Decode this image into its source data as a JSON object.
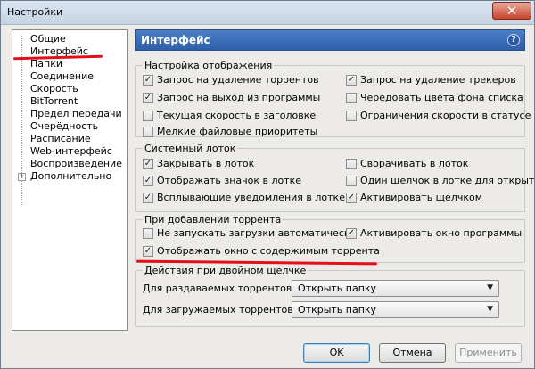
{
  "window": {
    "title": "Настройки",
    "close": "✕"
  },
  "sidebar": {
    "items": [
      {
        "label": "Общие"
      },
      {
        "label": "Интерфейс"
      },
      {
        "label": "Папки"
      },
      {
        "label": "Соединение"
      },
      {
        "label": "Скорость"
      },
      {
        "label": "BitTorrent"
      },
      {
        "label": "Предел передачи"
      },
      {
        "label": "Очерёдность"
      },
      {
        "label": "Расписание"
      },
      {
        "label": "Web-интерфейс"
      },
      {
        "label": "Воспроизведение"
      },
      {
        "label": "Дополнительно"
      }
    ],
    "expander": "+"
  },
  "header": {
    "title": "Интерфейс",
    "help": "?"
  },
  "display_group": {
    "title": "Настройка отображения",
    "options": [
      {
        "label": "Запрос на удаление торрентов",
        "checked": true
      },
      {
        "label": "Запрос на удаление трекеров",
        "checked": true
      },
      {
        "label": "Запрос на выход из программы",
        "checked": true
      },
      {
        "label": "Чередовать цвета фона списка",
        "checked": false
      },
      {
        "label": "Текущая скорость в заголовке",
        "checked": false
      },
      {
        "label": "Ограничения скорости в статусе",
        "checked": false
      },
      {
        "label": "Мелкие файловые приоритеты",
        "checked": false
      }
    ]
  },
  "tray_group": {
    "title": "Системный лоток",
    "options": [
      {
        "label": "Закрывать в лоток",
        "checked": true
      },
      {
        "label": "Сворачивать в лоток",
        "checked": false
      },
      {
        "label": "Отображать значок в лотке",
        "checked": true
      },
      {
        "label": "Один щелчок в лотке для открыти",
        "checked": false
      },
      {
        "label": "Всплывающие уведомления в лотке",
        "checked": true
      },
      {
        "label": "Активировать щелчком",
        "checked": true
      }
    ]
  },
  "add_group": {
    "title": "При добавлении торрента",
    "options": [
      {
        "label": "Не запускать загрузки автоматически",
        "checked": false
      },
      {
        "label": "Активировать окно программы",
        "checked": true
      },
      {
        "label": "Отображать окно с содержимым торрента",
        "checked": true
      }
    ]
  },
  "dblclick_group": {
    "title": "Действия при двойном щелчке",
    "seeding_label": "Для раздаваемых торрентов:",
    "seeding_value": "Открыть папку",
    "downloading_label": "Для загружаемых торрентов:",
    "downloading_value": "Открыть папку"
  },
  "footer": {
    "ok": "OK",
    "cancel": "Отмена",
    "apply": "Применить"
  },
  "check_mark": "✓",
  "chevron": "▼",
  "annotation_color": "#e3101b"
}
